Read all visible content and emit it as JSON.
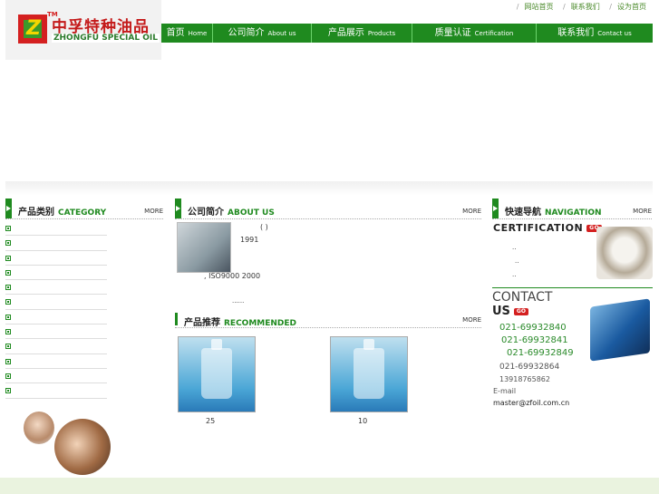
{
  "header": {
    "logo_mark": "Z",
    "logo_tm": "TM",
    "logo_cn": "中孚特种油品",
    "logo_en": "ZHONGFU SPECIAL OIL",
    "top_links": [
      "网站首页",
      "联系我们",
      "设为首页"
    ],
    "separator": "/"
  },
  "nav": [
    {
      "cn": "首页",
      "en": "Home"
    },
    {
      "cn": "公司简介",
      "en": "About us"
    },
    {
      "cn": "产品展示",
      "en": "Products"
    },
    {
      "cn": "质量认证",
      "en": "Certification"
    },
    {
      "cn": "联系我们",
      "en": "Contact us"
    }
  ],
  "category": {
    "cn": "产品类别",
    "en": "CATEGORY",
    "more": "MORE",
    "items": [
      "",
      "",
      "",
      "",
      "",
      "",
      "",
      "",
      "",
      "",
      "",
      ""
    ]
  },
  "about": {
    "cn": "公司简介",
    "en": "ABOUT US",
    "more": "MORE",
    "paren": "(          )",
    "year": "1991",
    "iso": ",   ISO9000 2000",
    "ellipsis": "......"
  },
  "recommended": {
    "cn": "产品推荐",
    "en": "RECOMMENDED",
    "more": "MORE",
    "products": [
      {
        "caption": "25"
      },
      {
        "caption": "10"
      }
    ]
  },
  "quick_nav": {
    "cn": "快速导航",
    "en": "NAVIGATION",
    "more": "MORE",
    "cert_title": "CERTIFICATION",
    "go": "GO",
    "cert_lines": [
      "..",
      "..",
      ".."
    ]
  },
  "contact": {
    "title_line1": "CONTACT",
    "title_line2": "US",
    "go": "GO",
    "phones": [
      "021-69932840",
      "021-69932841",
      "021-69932849"
    ],
    "fax": "021-69932864",
    "mobile": "13918765862",
    "email_label": "E-mail",
    "email": "master@zfoil.com.cn"
  },
  "colors": {
    "brand_green": "#1f8a1f",
    "brand_red": "#d42020",
    "phone_green": "#2a8a2a"
  }
}
